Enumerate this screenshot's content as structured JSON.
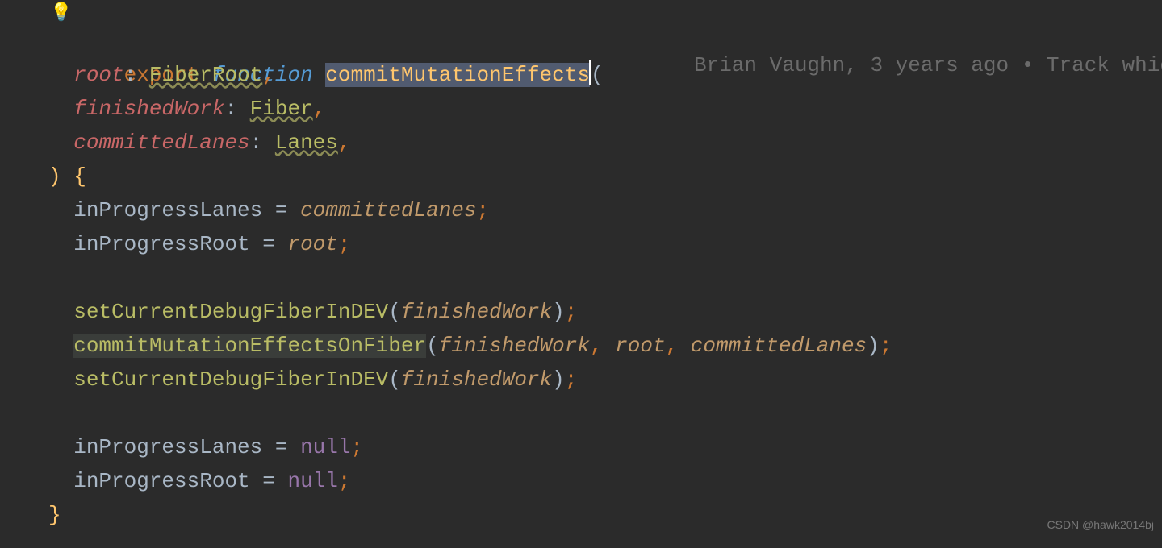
{
  "blame": {
    "author": "Brian Vaughn",
    "when": "3 years ago",
    "sep": "•",
    "msg": "Track whic"
  },
  "icons": {
    "bulb": "💡"
  },
  "code": {
    "kw_export": "export",
    "kw_function": "function",
    "fn_name": "commitMutationEffects",
    "params": {
      "root": "root",
      "root_type": "FiberRoot",
      "finished": "finishedWork",
      "finished_type": "Fiber",
      "lanes": "committedLanes",
      "lanes_type": "Lanes"
    },
    "body": {
      "inProgressLanes": "inProgressLanes",
      "inProgressRoot": "inProgressRoot",
      "committedLanes": "committedLanes",
      "root": "root",
      "setDbg": "setCurrentDebugFiberInDEV",
      "commitFn": "commitMutationEffectsOnFiber",
      "finishedWork": "finishedWork",
      "null": "null"
    },
    "eq": " = ",
    "colon": ": ",
    "comma": ",",
    "semi": ";",
    "lp": "(",
    "rp": ")",
    "lb": "{",
    "rb": "}"
  },
  "watermark": "CSDN @hawk2014bj"
}
